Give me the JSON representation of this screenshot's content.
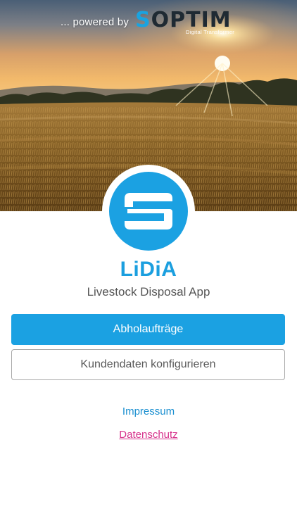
{
  "header": {
    "powered_by": "... powered by",
    "brand_logo_text": "SOPTIM",
    "brand_tagline": "Digital Transformer"
  },
  "app": {
    "logo_icon": "soptim-s-icon",
    "title": "LiDiA",
    "subtitle": "Livestock Disposal App"
  },
  "actions": {
    "primary_label": "Abholaufträge",
    "secondary_label": "Kundendaten konfigurieren"
  },
  "links": {
    "impressum": "Impressum",
    "datenschutz": "Datenschutz"
  },
  "colors": {
    "accent": "#1ba1e2",
    "link_blue": "#1a8fd0",
    "link_pink": "#d6308a"
  }
}
